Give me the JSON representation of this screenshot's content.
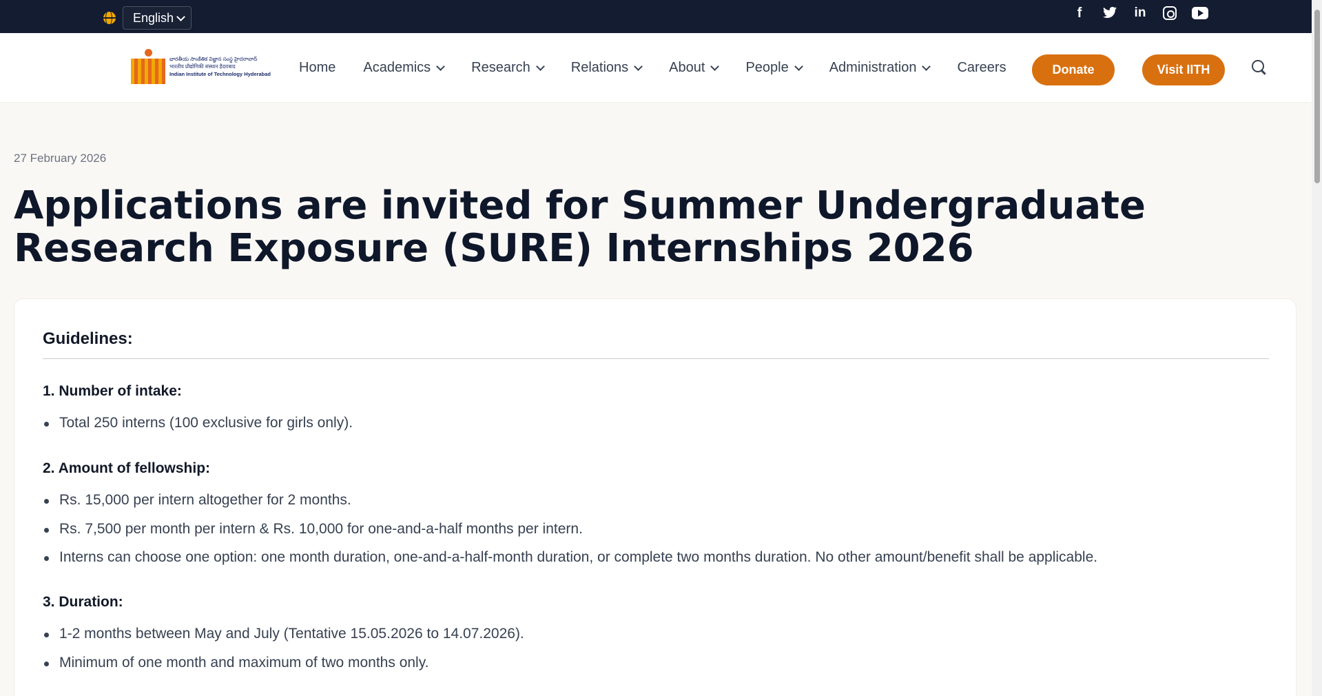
{
  "topbar": {
    "language": "English",
    "social_icons": [
      "facebook-icon",
      "twitter-icon",
      "linkedin-icon",
      "instagram-icon",
      "youtube-icon"
    ]
  },
  "logo": {
    "line1": "భారతీయ సాంకేతిక విజ్ఞాన సంస్థ హైదరాబాద్",
    "line2": "भारतीय प्रौद्योगिकी संस्थान हैदराबाद",
    "line3": "Indian Institute of Technology Hyderabad"
  },
  "nav": {
    "home": "Home",
    "academics": "Academics",
    "research": "Research",
    "relations": "Relations",
    "about": "About",
    "people": "People",
    "administration": "Administration",
    "careers": "Careers",
    "donate": "Donate",
    "visit": "Visit IITH"
  },
  "article": {
    "date": "27 February 2026",
    "title": "Applications are invited for Summer Undergraduate Research Exposure (SURE) Internships 2026",
    "guidelines_heading": "Guidelines:",
    "sections": [
      {
        "heading": "1. Number of intake:",
        "items": [
          "Total 250 interns (100 exclusive for girls only)."
        ]
      },
      {
        "heading": "2. Amount of fellowship:",
        "items": [
          "Rs. 15,000 per intern altogether for 2 months.",
          "Rs. 7,500 per month per intern & Rs. 10,000 for one-and-a-half months per intern.",
          "Interns can choose one option: one month duration, one-and-a-half-month duration, or complete two months duration. No other amount/benefit shall be applicable."
        ]
      },
      {
        "heading": "3. Duration:",
        "items": [
          "1-2 months between May and July (Tentative 15.05.2026 to 14.07.2026).",
          "Minimum of one month and maximum of two months only."
        ]
      }
    ]
  },
  "colors": {
    "topbar": "#131c30",
    "accent": "#d9700f",
    "title": "#0f172a"
  }
}
